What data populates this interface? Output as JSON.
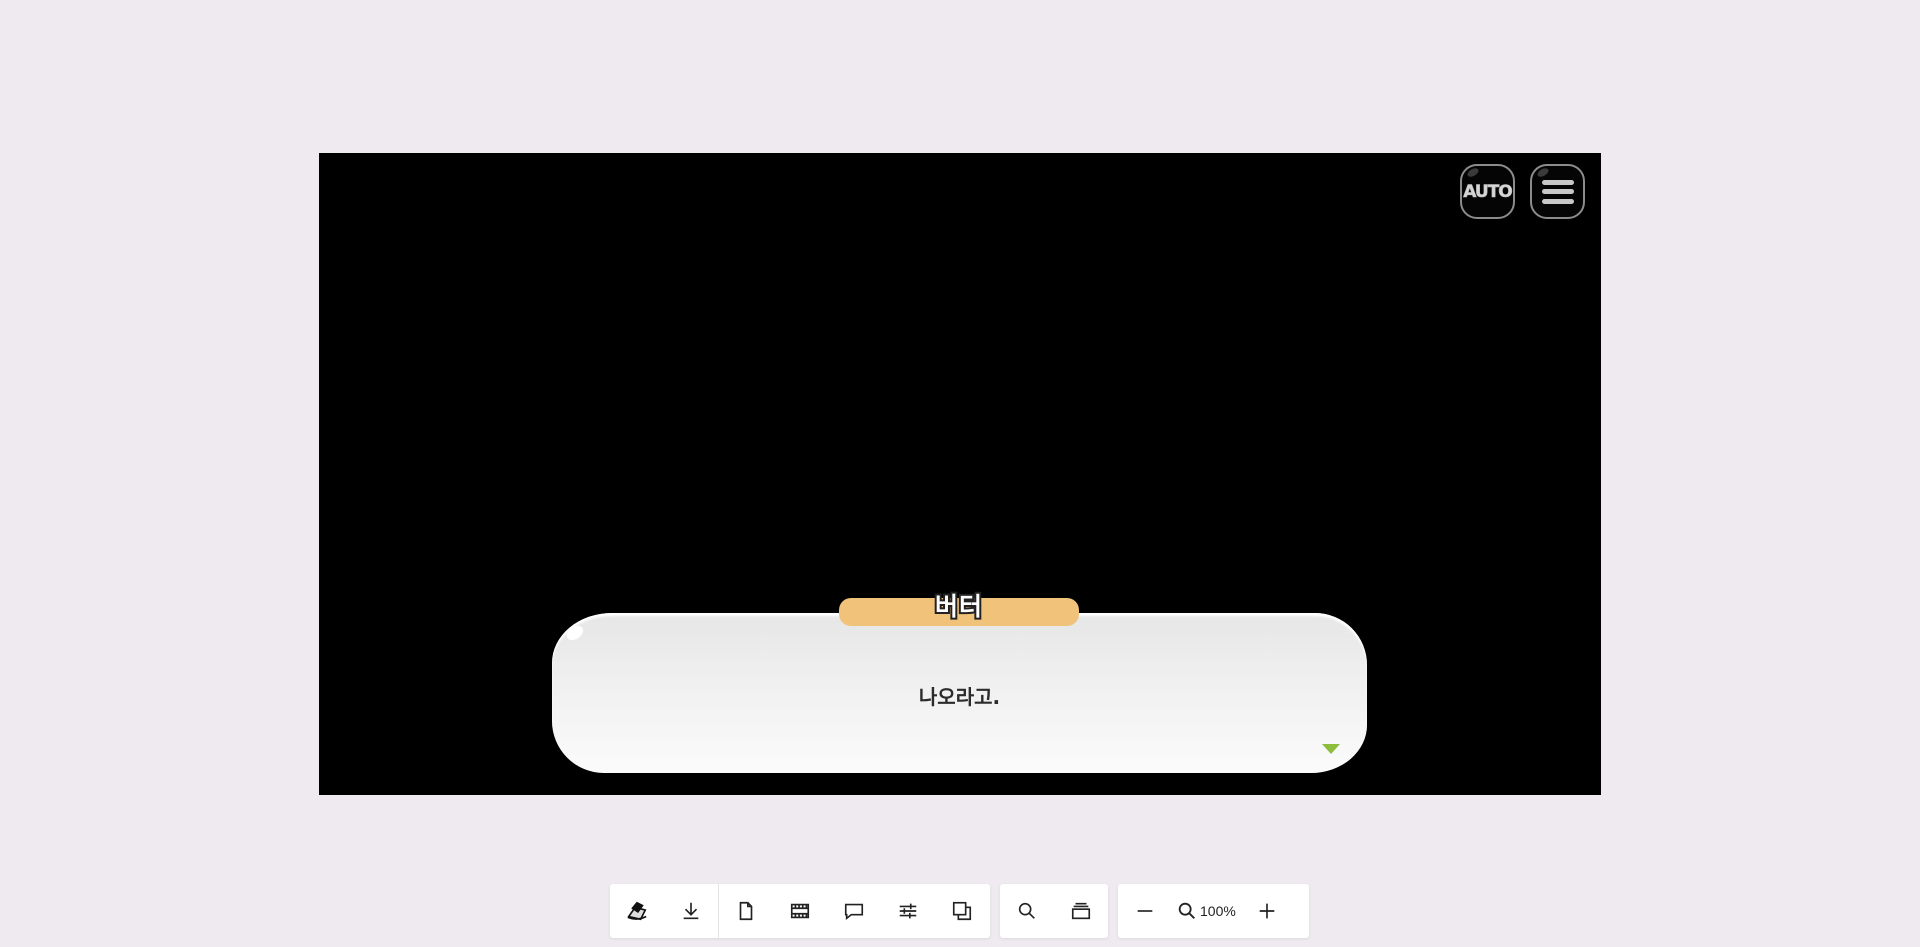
{
  "hud": {
    "auto_label": "AUTO",
    "menu_icon": "hamburger-menu-icon"
  },
  "dialog": {
    "speaker": "버터",
    "text": "나오라고.",
    "name_plate_color": "#f0c27a",
    "advance_icon": "chevron-down-icon",
    "advance_color": "#8dbd3a"
  },
  "toolbar": {
    "group1": [
      "logo-icon",
      "download-icon",
      "file-icon",
      "film-icon",
      "comment-icon",
      "sliders-icon",
      "layers-icon"
    ],
    "group2": [
      "search-icon",
      "window-icon"
    ],
    "zoom": {
      "out_icon": "minus-icon",
      "in_icon": "plus-icon",
      "value": "100%"
    }
  }
}
